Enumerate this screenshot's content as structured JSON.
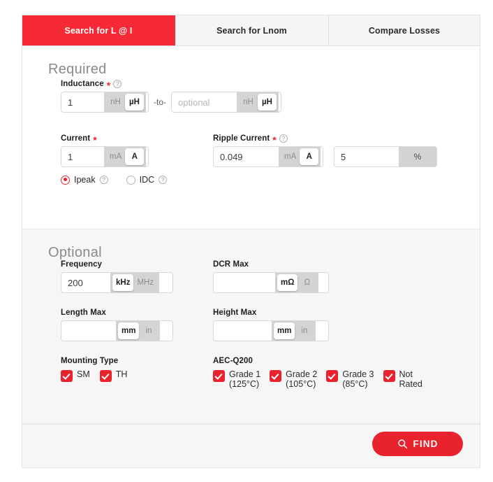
{
  "tabs": [
    {
      "label": "Search for L @ I",
      "active": true
    },
    {
      "label": "Search for Lnom",
      "active": false
    },
    {
      "label": "Compare Losses",
      "active": false
    }
  ],
  "required": {
    "title": "Required",
    "inductance": {
      "label": "Inductance",
      "required_mark": "*",
      "help": "?",
      "min_value": "1",
      "min_units": [
        "nH",
        "µH"
      ],
      "min_selected": "µH",
      "separator": "-to-",
      "max_placeholder": "optional",
      "max_value": "",
      "max_units": [
        "nH",
        "µH"
      ],
      "max_selected": "µH"
    },
    "current": {
      "label": "Current",
      "required_mark": "*",
      "value": "1",
      "units": [
        "mA",
        "A"
      ],
      "selected": "A",
      "modes": [
        {
          "label": "Ipeak",
          "help": "?",
          "selected": true
        },
        {
          "label": "IDC",
          "help": "?",
          "selected": false
        }
      ]
    },
    "ripple_current": {
      "label": "Ripple Current",
      "required_mark": "*",
      "help": "?",
      "value": "0.049",
      "units": [
        "mA",
        "A"
      ],
      "selected": "A",
      "percent_value": "5",
      "percent_suffix": "%"
    }
  },
  "optional": {
    "title": "Optional",
    "frequency": {
      "label": "Frequency",
      "value": "200",
      "units": [
        "kHz",
        "MHz"
      ],
      "selected": "kHz"
    },
    "dcr_max": {
      "label": "DCR Max",
      "value": "",
      "units": [
        "mΩ",
        "Ω"
      ],
      "selected": "mΩ"
    },
    "length_max": {
      "label": "Length Max",
      "value": "",
      "units": [
        "mm",
        "in"
      ],
      "selected": "mm"
    },
    "height_max": {
      "label": "Height Max",
      "value": "",
      "units": [
        "mm",
        "in"
      ],
      "selected": "mm"
    },
    "mounting_type": {
      "label": "Mounting Type",
      "options": [
        {
          "label": "SM",
          "checked": true
        },
        {
          "label": "TH",
          "checked": true
        }
      ]
    },
    "aec_q200": {
      "label": "AEC-Q200",
      "options": [
        {
          "line1": "Grade 1",
          "line2": "(125°C)",
          "checked": true
        },
        {
          "line1": "Grade 2",
          "line2": "(105°C)",
          "checked": true
        },
        {
          "line1": "Grade 3",
          "line2": "(85°C)",
          "checked": true
        },
        {
          "line1": "Not",
          "line2": "Rated",
          "checked": true
        }
      ]
    }
  },
  "footer": {
    "find_label": "FIND",
    "find_icon": "search-icon"
  },
  "colors": {
    "accent_red": "#e8232e",
    "tab_active_red": "#f62a36",
    "panel_bg": "#ffffff",
    "optional_bg": "#f6f6f6",
    "unit_track": "#d4d4d4"
  }
}
